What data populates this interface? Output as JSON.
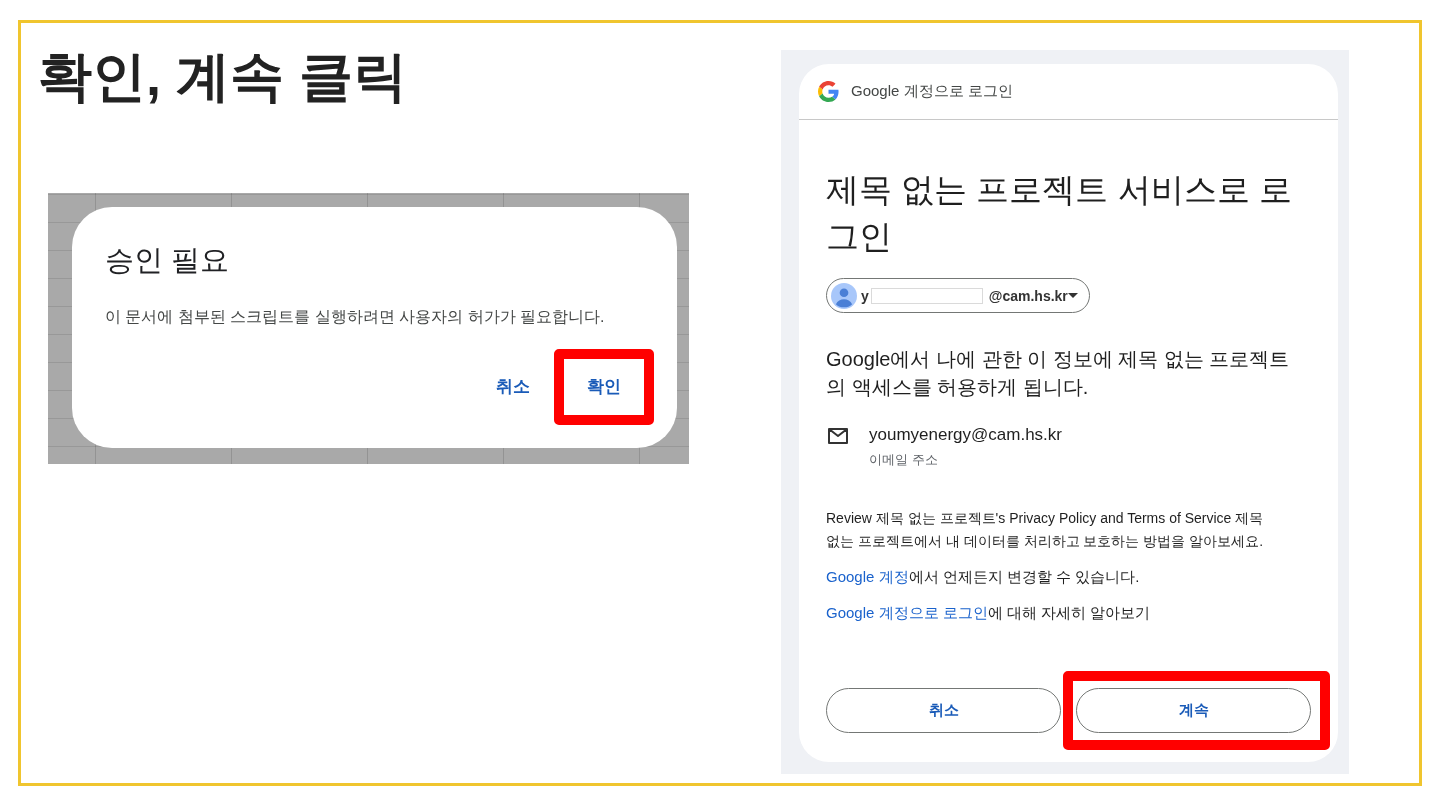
{
  "heading": "확인, 계속 클릭",
  "approval_dialog": {
    "title": "승인 필요",
    "message": "이 문서에 첨부된 스크립트를 실행하려면 사용자의 허가가 필요합니다.",
    "buttons": [
      {
        "label": "취소",
        "highlighted": false
      },
      {
        "label": "확인",
        "highlighted": true
      }
    ]
  },
  "signin_dialog": {
    "header": "Google 계정으로 로그인",
    "title": "제목 없는 프로젝트 서비스로 로그인",
    "account": {
      "text_start": "y",
      "redacted": true,
      "text_end": "@cam.hs.kr"
    },
    "description": "Google에서 나에 관한 이 정보에 제목 없는 프로젝트의 액세스를 허용하게 됩니다.",
    "email": {
      "value": "youmyenergy@cam.hs.kr",
      "label": "이메일 주소"
    },
    "policy_text": "Review 제목 없는 프로젝트's Privacy Policy and Terms of Service 제목 없는 프로젝트에서 내 데이터를 처리하고 보호하는 방법을 알아보세요.",
    "link_lines": [
      {
        "link": "Google 계정",
        "text": "에서 언제든지 변경할 수 있습니다."
      },
      {
        "link": "Google 계정으로 로그인",
        "text": "에 대해 자세히 알아보기"
      }
    ],
    "buttons": [
      {
        "label": "취소",
        "highlighted": false
      },
      {
        "label": "계속",
        "highlighted": true
      }
    ]
  }
}
